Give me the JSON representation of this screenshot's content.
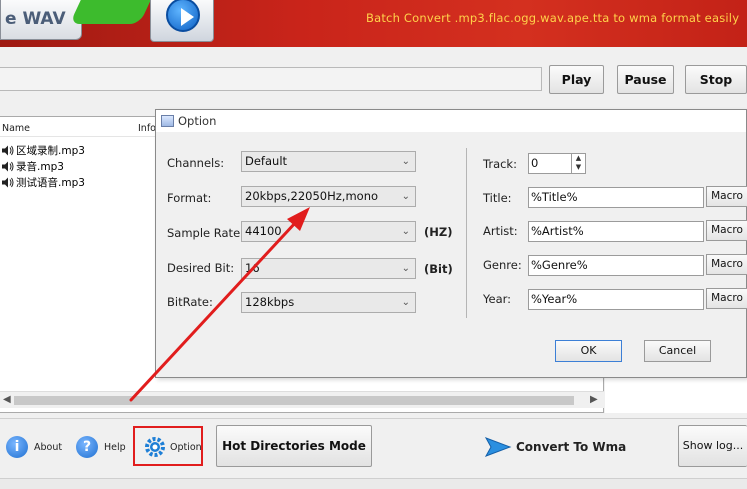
{
  "banner": {
    "logo_text": "e WAV",
    "logo_sub": "W",
    "tagline": "Batch Convert .mp3.flac.ogg.wav.ape.tta to wma format easily"
  },
  "toolbar": {
    "path_value": "",
    "play_label": "Play",
    "pause_label": "Pause",
    "stop_label": "Stop"
  },
  "file_list": {
    "columns": [
      "Name",
      "Info"
    ],
    "files": [
      "区域录制.mp3",
      "录音.mp3",
      "测试语音.mp3"
    ]
  },
  "option_dialog": {
    "title": "Option",
    "channels_label": "Channels:",
    "channels_value": "Default",
    "format_label": "Format:",
    "format_value": "20kbps,22050Hz,mono",
    "sample_rate_label": "Sample Rate:",
    "sample_rate_value": "44100",
    "sample_rate_unit": "(HZ)",
    "desired_bit_label": "Desired Bit:",
    "desired_bit_value": "16",
    "desired_bit_unit": "(Bit)",
    "bitrate_label": "BitRate:",
    "bitrate_value": "128kbps",
    "track_label": "Track:",
    "track_value": "0",
    "title_label": "Title:",
    "title_value": "%Title%",
    "artist_label": "Artist:",
    "artist_value": "%Artist%",
    "genre_label": "Genre:",
    "genre_value": "%Genre%",
    "year_label": "Year:",
    "year_value": "%Year%",
    "macro_label": "Macro",
    "ok_label": "OK",
    "cancel_label": "Cancel"
  },
  "bottom": {
    "about_label": "About",
    "help_label": "Help",
    "option_label": "Option",
    "hot_dir_label": "Hot Directories Mode",
    "convert_label": "Convert To Wma",
    "show_log_label": "Show log..."
  },
  "colors": {
    "banner_red": "#c9241a",
    "tagline_yellow": "#ffd24a",
    "annotation_red": "#e11d1d",
    "accent_blue": "#1e7fd6"
  },
  "icons": [
    "play-icon",
    "speaker-icon",
    "info-icon",
    "help-icon",
    "gear-icon",
    "convert-arrow-icon",
    "dialog-icon"
  ]
}
